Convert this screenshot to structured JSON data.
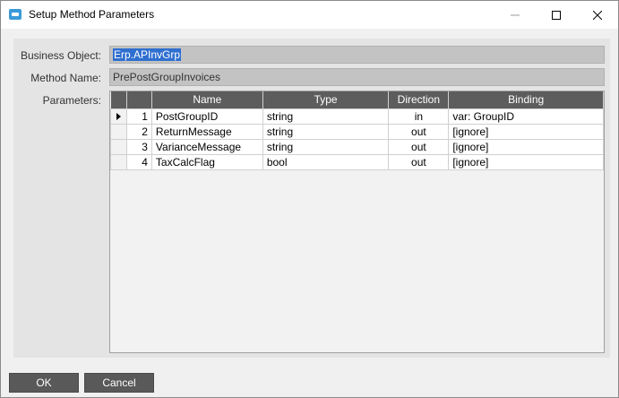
{
  "window": {
    "title": "Setup Method Parameters",
    "icon": "app-window-icon",
    "controls": {
      "minimize": "minimize-icon",
      "maximize": "maximize-icon",
      "close": "close-icon"
    }
  },
  "form": {
    "business_object_label": "Business Object:",
    "business_object_value": "Erp.APInvGrp",
    "method_name_label": "Method Name:",
    "method_name_value": "PrePostGroupInvoices",
    "parameters_label": "Parameters:"
  },
  "grid": {
    "columns": [
      "Name",
      "Type",
      "Direction",
      "Binding"
    ],
    "rows": [
      {
        "num": "1",
        "name": "PostGroupID",
        "type": "string",
        "direction": "in",
        "binding": "var: GroupID"
      },
      {
        "num": "2",
        "name": "ReturnMessage",
        "type": "string",
        "direction": "out",
        "binding": "[ignore]"
      },
      {
        "num": "3",
        "name": "VarianceMessage",
        "type": "string",
        "direction": "out",
        "binding": "[ignore]"
      },
      {
        "num": "4",
        "name": "TaxCalcFlag",
        "type": "bool",
        "direction": "out",
        "binding": "[ignore]"
      }
    ],
    "current_row": 1
  },
  "buttons": {
    "ok": "OK",
    "cancel": "Cancel"
  },
  "colors": {
    "header": "#5d5d5d",
    "button": "#595959",
    "selection": "#2f6fd0",
    "field": "#c3c3c3"
  }
}
